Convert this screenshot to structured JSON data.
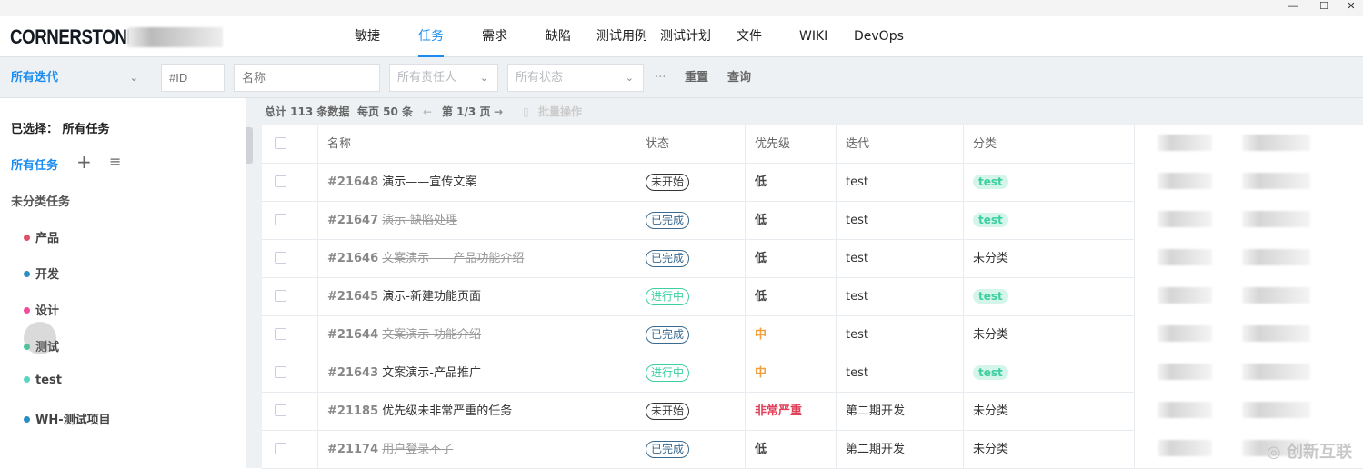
{
  "window": {
    "controls": [
      "minimize",
      "maximize",
      "close"
    ]
  },
  "header": {
    "logo": "CORNERSTONE",
    "nav": [
      {
        "label": "敏捷"
      },
      {
        "label": "任务",
        "active": true
      },
      {
        "label": "需求"
      },
      {
        "label": "缺陷"
      },
      {
        "label": "测试用例"
      },
      {
        "label": "测试计划"
      },
      {
        "label": "文件"
      },
      {
        "label": "WIKI"
      },
      {
        "label": "DevOps"
      }
    ]
  },
  "filters": {
    "iteration": "所有迭代",
    "id_placeholder": "#ID",
    "name_placeholder": "名称",
    "assignee": "所有责任人",
    "status": "所有状态",
    "more": "···",
    "reset": "重置",
    "query": "查询"
  },
  "sidebar": {
    "selected_label": "已选择：",
    "selected_value": "所有任务",
    "all_tasks": "所有任务",
    "uncategorized": "未分类任务",
    "categories": [
      {
        "label": "产品",
        "color": "#e0506a"
      },
      {
        "label": "开发",
        "color": "#2a8fc0"
      },
      {
        "label": "设计",
        "color": "#f04d9a"
      },
      {
        "label": "测试",
        "color": "#3ccfa0"
      },
      {
        "label": "test",
        "color": "#5ad6c0"
      },
      {
        "label": "WH-测试项目",
        "color": "#2a8fc0"
      }
    ]
  },
  "summary": {
    "total": "总计 113 条数据",
    "per_page": "每页 50 条",
    "page": "第 1/3 页",
    "batch": "批量操作"
  },
  "table": {
    "columns": [
      "名称",
      "状态",
      "优先级",
      "迭代",
      "分类"
    ],
    "rows": [
      {
        "id": "#21648",
        "name": "演示——宣传文案",
        "done": false,
        "status": "未开始",
        "priority": "低",
        "iteration": "test",
        "category": "test"
      },
      {
        "id": "#21647",
        "name": "演示-缺陷处理",
        "done": true,
        "status": "已完成",
        "priority": "低",
        "iteration": "test",
        "category": "test"
      },
      {
        "id": "#21646",
        "name": "文案演示——产品功能介绍",
        "done": true,
        "status": "已完成",
        "priority": "低",
        "iteration": "test",
        "category": "未分类"
      },
      {
        "id": "#21645",
        "name": "演示-新建功能页面",
        "done": false,
        "status": "进行中",
        "priority": "低",
        "iteration": "test",
        "category": "test"
      },
      {
        "id": "#21644",
        "name": "文案演示-功能介绍",
        "done": true,
        "status": "已完成",
        "priority": "中",
        "iteration": "test",
        "category": "未分类"
      },
      {
        "id": "#21643",
        "name": "文案演示-产品推广",
        "done": false,
        "status": "进行中",
        "priority": "中",
        "iteration": "test",
        "category": "test"
      },
      {
        "id": "#21185",
        "name": "优先级未非常严重的任务",
        "done": false,
        "status": "未开始",
        "priority": "非常严重",
        "iteration": "第二期开发",
        "category": "未分类"
      },
      {
        "id": "#21174",
        "name": "用户登录不了",
        "done": true,
        "status": "已完成",
        "priority": "低",
        "iteration": "第二期开发",
        "category": "未分类"
      }
    ]
  },
  "colors": {
    "accent": "#1a8cf0",
    "status": {
      "未开始": "#333333",
      "已完成": "#3a6a8f",
      "进行中": "#3ccfa0"
    },
    "priority": {
      "低": "#444444",
      "中": "#f0a040",
      "非常严重": "#e0405a"
    }
  },
  "watermark": "创新互联"
}
